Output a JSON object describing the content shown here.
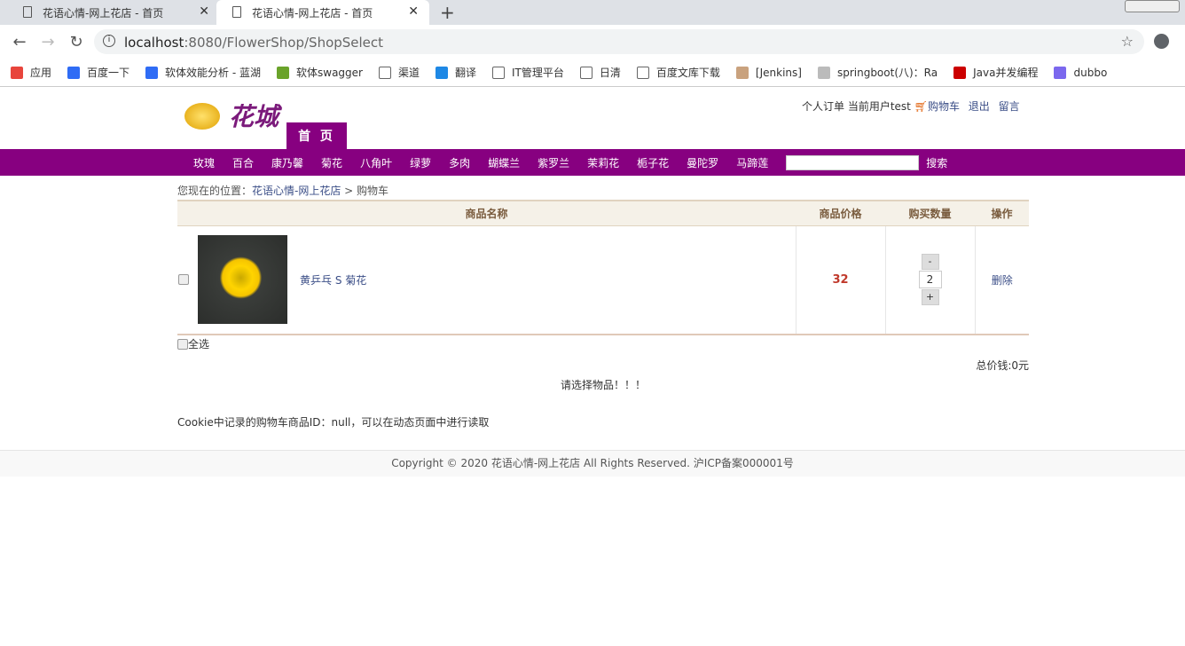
{
  "browser": {
    "tabs": [
      {
        "title": "花语心情-网上花店 - 首页"
      },
      {
        "title": "花语心情-网上花店 - 首页"
      }
    ],
    "url_host": "localhost",
    "url_rest": ":8080/FlowerShop/ShopSelect",
    "bookmarks": [
      {
        "label": "应用",
        "color": "#e8453c"
      },
      {
        "label": "百度一下",
        "color": "#2f6cf5"
      },
      {
        "label": "软体效能分析 - 蓝湖",
        "color": "#2f6cf5"
      },
      {
        "label": "软体swagger",
        "color": "#6aa32a"
      },
      {
        "label": "渠道",
        "color": "#fff"
      },
      {
        "label": "翻译",
        "color": "#1e88e5"
      },
      {
        "label": "IT管理平台",
        "color": "#fff"
      },
      {
        "label": "日清",
        "color": "#fff"
      },
      {
        "label": "百度文库下载",
        "color": "#fff"
      },
      {
        "label": "[Jenkins]",
        "color": "#c9a27e"
      },
      {
        "label": "springboot(八)：Ra",
        "color": "#bbb"
      },
      {
        "label": "Java并发编程",
        "color": "#c00"
      },
      {
        "label": "dubbo",
        "color": "#7b68ee"
      }
    ]
  },
  "header": {
    "logo_text": "花城",
    "home": "首 页",
    "links": {
      "orders": "个人订单",
      "user": "当前用户test",
      "cart": "购物车",
      "logout": "退出",
      "message": "留言"
    }
  },
  "menu": [
    "玫瑰",
    "百合",
    "康乃馨",
    "菊花",
    "八角叶",
    "绿萝",
    "多肉",
    "蝴蝶兰",
    "紫罗兰",
    "茉莉花",
    "栀子花",
    "曼陀罗",
    "马蹄莲"
  ],
  "search": {
    "value": "",
    "button": "搜索"
  },
  "breadcrumb": {
    "prefix": "您现在的位置：",
    "home": "花语心情-网上花店",
    "sep": " > ",
    "current": "购物车"
  },
  "table": {
    "headers": [
      "商品名称",
      "商品价格",
      "购买数量",
      "操作"
    ],
    "rows": [
      {
        "name": "黄乒乓 S 菊花",
        "price": "32",
        "qty": "2",
        "minus": "-",
        "plus": "+",
        "action": "删除"
      }
    ]
  },
  "select_all": "全选",
  "total": "总价钱:0元",
  "notice": "请选择物品！！！",
  "cookie_text": "Cookie中记录的购物车商品ID：null，可以在动态页面中进行读取",
  "footer": "Copyright © 2020 花语心情-网上花店 All Rights Reserved. 沪ICP备案000001号"
}
